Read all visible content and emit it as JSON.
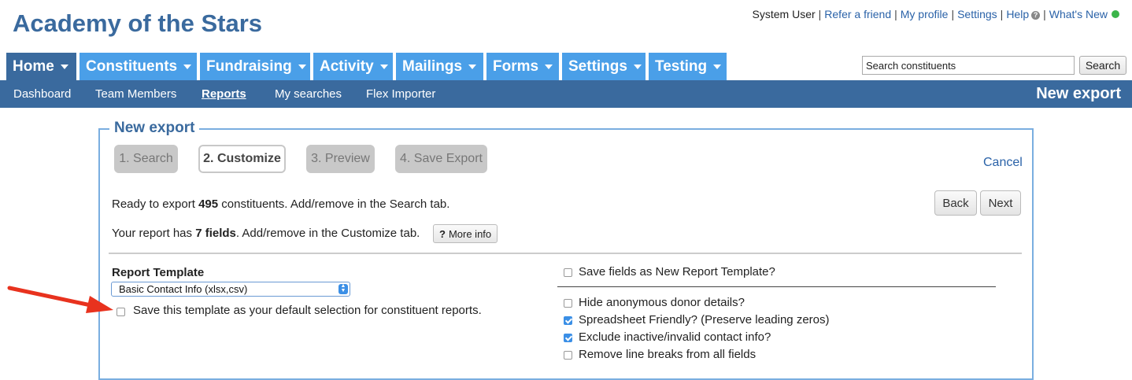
{
  "app": {
    "title": "Academy of the Stars"
  },
  "toplinks": {
    "user": "System User",
    "refer": "Refer a friend",
    "profile": "My profile",
    "settings": "Settings",
    "help": "Help",
    "help_icon": "?",
    "whats_new": "What's New",
    "status_color": "#3bb54a"
  },
  "main_tabs": [
    {
      "label": "Home"
    },
    {
      "label": "Constituents"
    },
    {
      "label": "Fundraising"
    },
    {
      "label": "Activity"
    },
    {
      "label": "Mailings"
    },
    {
      "label": "Forms"
    },
    {
      "label": "Settings"
    },
    {
      "label": "Testing"
    }
  ],
  "search": {
    "value": "Search constituents",
    "button": "Search"
  },
  "subnav": {
    "items": [
      "Dashboard",
      "Team Members",
      "Reports",
      "My searches",
      "Flex Importer"
    ],
    "current": "Reports",
    "page_title": "New export"
  },
  "panel": {
    "legend": "New export",
    "steps": [
      "1. Search",
      "2. Customize",
      "3. Preview",
      "4. Save Export"
    ],
    "current_step": "2. Customize",
    "cancel": "Cancel",
    "ready_pre": "Ready to export ",
    "ready_count": "495",
    "ready_post": " constituents. Add/remove in the Search tab.",
    "fields_pre": "Your report has ",
    "fields_count": "7 fields",
    "fields_post": ". Add/remove in the Customize tab.",
    "more_info_icon": "?",
    "more_info": "More info",
    "back": "Back",
    "next": "Next",
    "template_label": "Report Template",
    "template_value": "Basic Contact Info (xlsx,csv)",
    "default_checkbox": {
      "label": "Save this template as your default selection for constituent reports.",
      "checked": false
    },
    "save_template": {
      "label": "Save fields as New Report Template?",
      "checked": false
    },
    "options": [
      {
        "label": "Hide anonymous donor details?",
        "checked": false
      },
      {
        "label": "Spreadsheet Friendly? (Preserve leading zeros)",
        "checked": true
      },
      {
        "label": "Exclude inactive/invalid contact info?",
        "checked": true
      },
      {
        "label": "Remove line breaks from all fields",
        "checked": false
      }
    ]
  },
  "colors": {
    "brand": "#3a6a9e",
    "tab": "#4a9fe8",
    "link": "#2a62a8",
    "annotation_arrow": "#e8321e"
  }
}
